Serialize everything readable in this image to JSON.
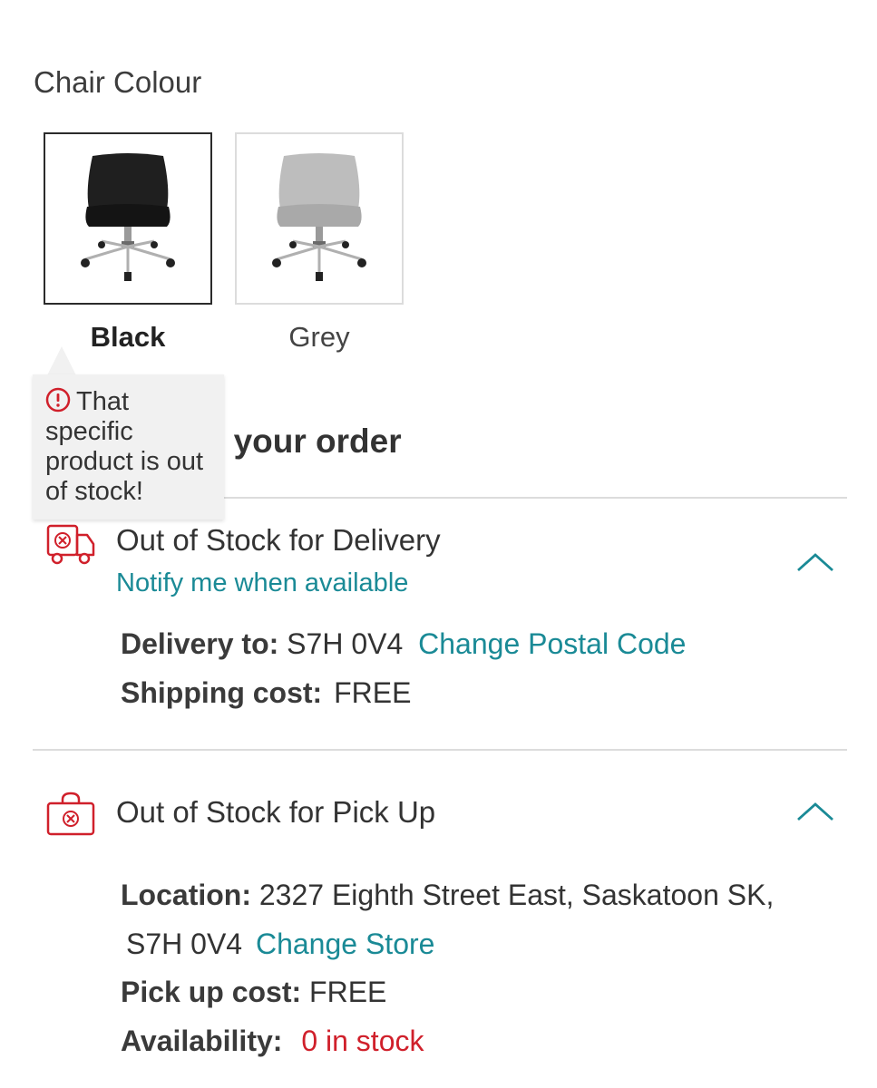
{
  "colour_selector": {
    "label": "Chair Colour",
    "options": [
      {
        "name": "Black",
        "selected": true,
        "seat_color": "#1e1e1e"
      },
      {
        "name": "Grey",
        "selected": false,
        "seat_color": "#b9b9b9"
      }
    ]
  },
  "tooltip": {
    "icon": "exclamation-circle-icon",
    "message": "That specific product is out of stock!",
    "icon_color": "#d0202b"
  },
  "order": {
    "heading_visible": "t your order"
  },
  "delivery": {
    "icon": "truck-blocked-icon",
    "title": "Out of Stock for Delivery",
    "notify_link": "Notify me when available",
    "delivery_to_label": "Delivery to:",
    "delivery_to_value": "S7H 0V4",
    "change_postal_link": "Change Postal Code",
    "shipping_label": "Shipping cost:",
    "shipping_value": "FREE"
  },
  "pickup": {
    "icon": "bag-blocked-icon",
    "title": "Out of Stock for Pick Up",
    "location_label": "Location:",
    "location_value": "2327 Eighth Street East,  Saskatoon SK,",
    "location_line2": "S7H 0V4",
    "change_store_link": "Change Store",
    "pickup_cost_label": "Pick up cost:",
    "pickup_cost_value": "FREE",
    "availability_label": "Availability:",
    "availability_value": "0 in stock"
  },
  "colors": {
    "accent_teal": "#1a8a96",
    "alert_red": "#d0202b",
    "text": "#333333"
  }
}
